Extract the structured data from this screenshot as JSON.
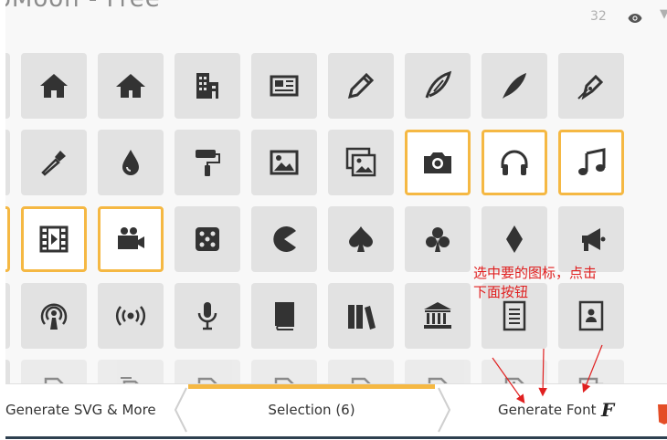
{
  "header": {
    "title": "oMoon - Free",
    "count": "32"
  },
  "colors": {
    "tile": "#e2e2e2",
    "selected_border": "#f5b843",
    "icon": "#333333",
    "annotation": "#e02020",
    "bar_bottom": "#2e4050"
  },
  "grid": {
    "rows": [
      [
        "home-icon",
        "home2-icon",
        "office-icon",
        "newspaper-icon",
        "pencil-icon",
        "quill-icon",
        "feather-icon",
        "pen-icon"
      ],
      [
        "eyedropper-icon",
        "droplet-icon",
        "paint-roller-icon",
        "image-icon",
        "images-icon",
        "camera-icon",
        "headphones-icon",
        "music-icon"
      ],
      [
        "film-icon",
        "video-camera-icon",
        "dice-icon",
        "pacman-icon",
        "spades-icon",
        "clubs-icon",
        "diamonds-icon",
        "bullhorn-icon"
      ],
      [
        "podcast-icon",
        "connection-icon",
        "mic-icon",
        "book-icon",
        "books-icon",
        "library-icon",
        "file-text-icon",
        "profile-icon"
      ],
      [
        "file-empty-icon",
        "files-empty-icon",
        "file-picture-icon",
        "file-music-icon",
        "file-play-icon",
        "file-video-icon",
        "file-zip-icon",
        "copy-icon"
      ]
    ],
    "selected": [
      "camera-icon",
      "headphones-icon",
      "music-icon",
      "film-icon",
      "video-camera-icon"
    ]
  },
  "annotation": {
    "line1": "选中要的图标，点击",
    "line2": "下面按钮"
  },
  "bottom_bar": {
    "generate_svg_label": "Generate SVG & More",
    "selection_label": "Selection (6)",
    "generate_font_label": "Generate Font",
    "font_icon_glyph": "F"
  }
}
